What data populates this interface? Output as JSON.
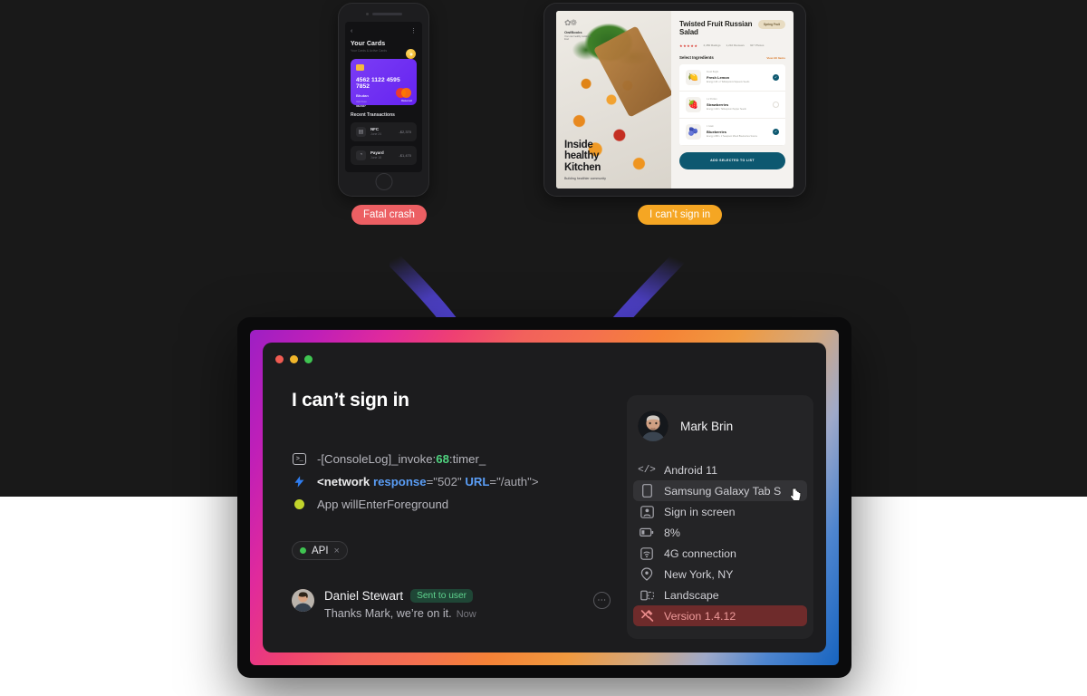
{
  "colors": {
    "page_background": "#ffffff",
    "band_background": "#191919",
    "crash_badge": "#ec5f63",
    "signin_badge": "#f5a623",
    "accent_green": "#4fd37f",
    "accent_blue": "#5a9df5",
    "error_red": "#6e2b2b",
    "purple_arrow": "#5b4bf5"
  },
  "phone_mockup": {
    "topbar": {
      "back_icon": "‹",
      "menu_icon": "⋮"
    },
    "heading": "Your Cards",
    "subheading": "Your Cards & Active Cards",
    "coin_icon": "coin-icon",
    "card": {
      "chip_icon": "chip-icon",
      "number": "4562 1122 4595 7852",
      "holder": "Bhutan",
      "expiry_label": "Valid Date",
      "expiry": "06/2027",
      "brand": "Mastercard",
      "brand_label": "Mastercard"
    },
    "transactions_heading": "Recent Transactions",
    "transactions": [
      {
        "icon": "bank-icon",
        "title": "NFC",
        "date": "June 24",
        "amount": "-$2,370"
      },
      {
        "icon": "payment-icon",
        "title": "Payard",
        "date": "June 18",
        "amount": "-$1,470"
      }
    ]
  },
  "tablet_mockup": {
    "brand": {
      "mark": "logo-mark",
      "name": "OwlBooks",
      "tagline": "Your own healthy cooking & food"
    },
    "hero_title": "Inside\nhealthy\nKitchen",
    "hero_subtitle": "Building healthier community",
    "recipe_title": "Twisted Fruit Russian Salad",
    "pill_label": "Spring Fruit",
    "stars": "★★★★★",
    "meta": [
      "2,450 Ratings",
      "1,210 Reviews",
      "327 Photos"
    ],
    "section_heading": "Select Ingredients",
    "section_link": "View All Items",
    "ingredients": [
      {
        "kicker": "Fresh Bright",
        "name": "Fresh Lemon",
        "detail": "Energy 140 • 2 Tablespoons Squeeze Seeds",
        "selected": true,
        "icon": "lemon-icon"
      },
      {
        "kicker": "1,2 Portion",
        "name": "Strawberries",
        "detail": "Energy 1420 • Tablespoon Pepper Seeds",
        "selected": false,
        "icon": "strawberry-icon"
      },
      {
        "kicker": "1 Grain",
        "name": "Blueberries",
        "detail": "Energy 2480 • 1 Teaspoon Mixed Blueberries Source",
        "selected": true,
        "icon": "blueberry-icon"
      }
    ],
    "cta_label": "ADD SELECTED TO LIST"
  },
  "badges": {
    "crash": "Fatal crash",
    "signin": "I can’t sign in"
  },
  "laptop": {
    "window_dots": [
      "close",
      "minimize",
      "maximize"
    ],
    "ticket": {
      "title": "I can’t sign in",
      "logs": [
        {
          "icon": "terminal-icon",
          "glyph": ">_",
          "parts": [
            {
              "text": "-[ConsoleLog]_invoke:",
              "style": "plain"
            },
            {
              "text": "68",
              "style": "num"
            },
            {
              "text": ":timer_",
              "style": "plain"
            }
          ]
        },
        {
          "icon": "network-bolt-icon",
          "glyph": "",
          "parts": [
            {
              "text": "<network ",
              "style": "tag"
            },
            {
              "text": "response",
              "style": "attr"
            },
            {
              "text": "=\"502\" ",
              "style": "val"
            },
            {
              "text": "URL",
              "style": "attr"
            },
            {
              "text": "=\"/auth\">",
              "style": "val"
            }
          ]
        },
        {
          "icon": "status-dot-icon",
          "glyph": "",
          "parts": [
            {
              "text": "App willEnterForeground",
              "style": "plain"
            }
          ]
        }
      ],
      "tags": [
        {
          "label": "API",
          "dot": "#3fc451",
          "remove_icon": "×"
        }
      ],
      "comment": {
        "author": "Daniel Stewart",
        "badge": "Sent to user",
        "text": "Thanks Mark, we’re on it.",
        "time": "Now",
        "more_icon": "⋯",
        "avatar": "avatar"
      }
    },
    "device_panel": {
      "user_name": "Mark Brin",
      "user_avatar": "avatar",
      "rows": [
        {
          "icon": "code-icon",
          "glyph": "</>",
          "label": "Android 11",
          "state": "normal"
        },
        {
          "icon": "device-tablet-icon",
          "glyph": "",
          "label": "Samsung Galaxy Tab S",
          "state": "hovered"
        },
        {
          "icon": "screen-user-icon",
          "glyph": "",
          "label": "Sign in screen",
          "state": "normal"
        },
        {
          "icon": "battery-icon",
          "glyph": "",
          "label": "8%",
          "state": "normal"
        },
        {
          "icon": "wifi-signal-icon",
          "glyph": "",
          "label": "4G connection",
          "state": "normal"
        },
        {
          "icon": "location-pin-icon",
          "glyph": "",
          "label": "New York, NY",
          "state": "normal"
        },
        {
          "icon": "orientation-landscape-icon",
          "glyph": "",
          "label": "Landscape",
          "state": "normal"
        },
        {
          "icon": "wrench-tools-icon",
          "glyph": "",
          "label": "Version 1.4.12",
          "state": "error"
        }
      ]
    }
  }
}
